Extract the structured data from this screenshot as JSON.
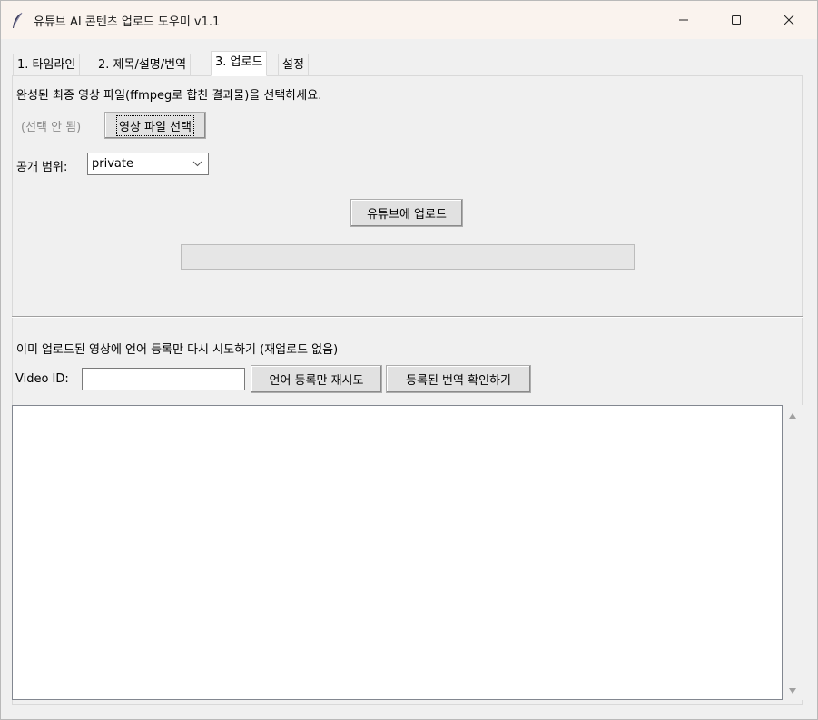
{
  "window": {
    "title": "유튜브 AI 콘텐츠 업로드 도우미 v1.1",
    "icon": "feather-icon",
    "controls": [
      "minimize-icon",
      "maximize-icon",
      "close-icon"
    ]
  },
  "tabs": [
    {
      "label": "1. 타임라인",
      "active": false
    },
    {
      "label": "2. 제목/설명/번역",
      "active": false
    },
    {
      "label": "3. 업로드",
      "active": true
    },
    {
      "label": "설정",
      "active": false
    }
  ],
  "upload": {
    "instruction": "완성된 최종 영상 파일(ffmpeg로 합친 결과물)을 선택하세요.",
    "file_status": "(선택 안 됨)",
    "select_button": "영상 파일 선택",
    "privacy_label": "공개 범위:",
    "privacy_value": "private",
    "upload_button": "유튜브에 업로드",
    "progress": 0
  },
  "retry": {
    "heading": "이미 업로드된 영상에 언어 등록만 다시 시도하기 (재업로드 없음)",
    "video_id_label": "Video ID:",
    "video_id_value": "",
    "retry_button": "언어 등록만 재시도",
    "check_button": "등록된 번역 확인하기"
  },
  "log": {
    "text": ""
  },
  "colors": {
    "titlebar": "#faf3ee",
    "window_bg": "#f0f0f0",
    "button_bg": "#e1e1e1",
    "disabled_text": "#8c8c8c"
  }
}
